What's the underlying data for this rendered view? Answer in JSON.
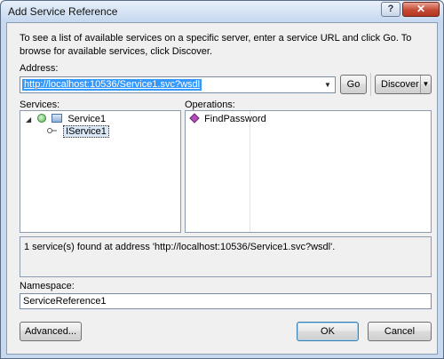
{
  "dialog": {
    "title": "Add Service Reference",
    "help_label": "?",
    "close_label": "✕"
  },
  "intro_text": "To see a list of available services on a specific server, enter a service URL and click Go. To browse for available services, click Discover.",
  "address": {
    "label": "Address:",
    "value": "http://localhost:10536/Service1.svc?wsdl",
    "dropdown_icon": "chevron-down-icon"
  },
  "buttons": {
    "go": "Go",
    "discover": "Discover",
    "advanced": "Advanced...",
    "ok": "OK",
    "cancel": "Cancel"
  },
  "services": {
    "label": "Services:",
    "tree": [
      {
        "label": "Service1",
        "icon": "service-icon",
        "expanded": true
      },
      {
        "label": "IService1",
        "icon": "interface-icon",
        "selected": true
      }
    ]
  },
  "operations": {
    "label": "Operations:",
    "items": [
      "FindPassword"
    ]
  },
  "status_text": "1 service(s) found at address 'http://localhost:10536/Service1.svc?wsdl'.",
  "namespace": {
    "label": "Namespace:",
    "value": "ServiceReference1"
  }
}
